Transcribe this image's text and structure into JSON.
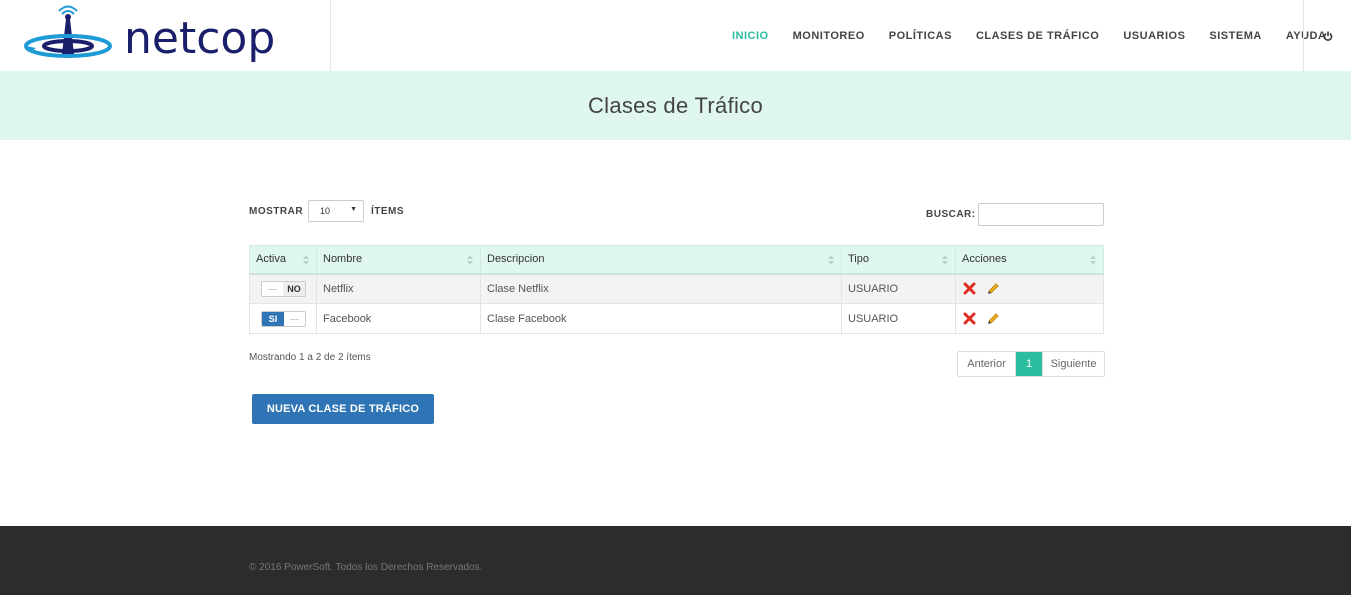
{
  "brand": {
    "name": "netcop"
  },
  "colors": {
    "accent": "#2bbd9e",
    "primary": "#2f74b5",
    "brand_navy": "#1a1f6b",
    "brand_cyan": "#1e9ad6",
    "title_band": "#dff7ee",
    "footer": "#2c2c2c"
  },
  "nav": {
    "items": [
      {
        "label": "INICIO",
        "active": true
      },
      {
        "label": "MONITOREO"
      },
      {
        "label": "POLÍTICAS"
      },
      {
        "label": "CLASES DE TRÁFICO"
      },
      {
        "label": "USUARIOS"
      },
      {
        "label": "SISTEMA"
      },
      {
        "label": "AYUDA"
      }
    ],
    "power_icon": "power-icon"
  },
  "page": {
    "title": "Clases de Tráfico"
  },
  "controls": {
    "show_label": "MOSTRAR",
    "page_size": "10",
    "items_label": "ÍTEMS",
    "search_label": "BUSCAR:",
    "search_value": ""
  },
  "table": {
    "columns": [
      "Activa",
      "Nombre",
      "Descripcion",
      "Tipo",
      "Acciones"
    ],
    "rows": [
      {
        "active": false,
        "active_label": "NO",
        "name": "Netflix",
        "description": "Clase Netflix",
        "type": "USUARIO"
      },
      {
        "active": true,
        "active_label": "SI",
        "name": "Facebook",
        "description": "Clase Facebook",
        "type": "USUARIO"
      }
    ],
    "action_icons": [
      "delete-icon",
      "edit-icon"
    ]
  },
  "info": "Mostrando 1 a 2 de 2 ítems",
  "pagination": {
    "prev": "Anterior",
    "current": "1",
    "next": "Siguiente"
  },
  "new_button": "NUEVA CLASE DE TRÁFICO",
  "footer": {
    "copyright": "© 2016 PowerSoft. Todos los Derechos Reservados."
  }
}
